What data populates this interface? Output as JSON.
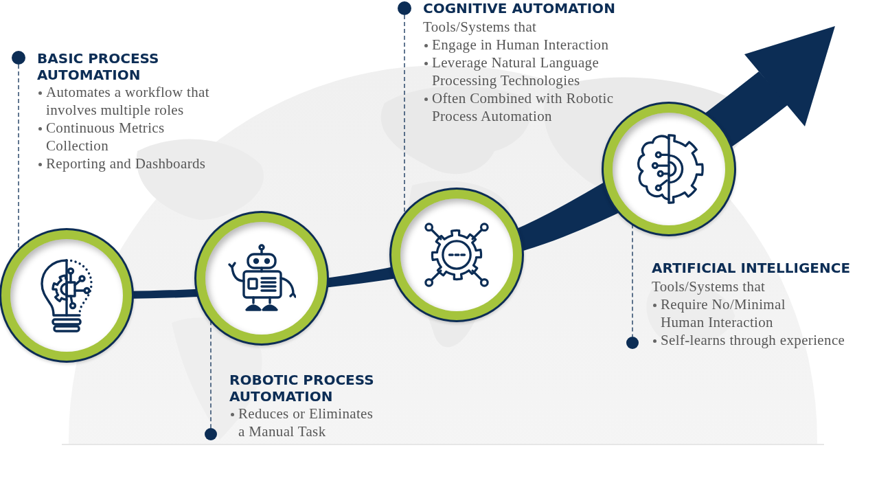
{
  "stages": [
    {
      "title": "BASIC PROCESS AUTOMATION",
      "bullets": [
        "Automates a workflow that\ninvolves multiple roles",
        "Continuous Metrics\nCollection",
        "Reporting and Dashboards"
      ]
    },
    {
      "title": "ROBOTIC PROCESS AUTOMATION",
      "bullets": [
        "Reduces or Eliminates\na Manual Task"
      ]
    },
    {
      "title": "COGNITIVE AUTOMATION",
      "intro": "Tools/Systems that",
      "bullets": [
        "Engage in Human Interaction",
        "Leverage Natural Language\nProcessing Technologies",
        "Often Combined with Robotic\nProcess Automation"
      ]
    },
    {
      "title": "ARTIFICIAL INTELLIGENCE",
      "intro": "Tools/Systems that",
      "bullets": [
        "Require No/Minimal\nHuman Interaction",
        "Self-learns through experience"
      ]
    }
  ]
}
